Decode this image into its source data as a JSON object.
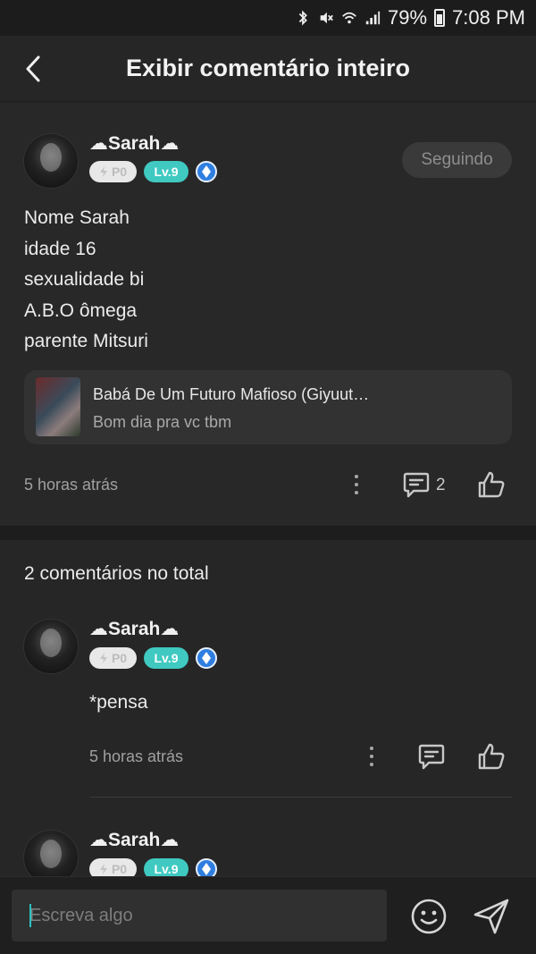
{
  "status_bar": {
    "battery": "79%",
    "time": "7:08 PM"
  },
  "header": {
    "title": "Exibir comentário inteiro"
  },
  "post": {
    "username": "☁Sarah☁",
    "badge_p": "P0",
    "badge_lv": "Lv.9",
    "follow_label": "Seguindo",
    "text_lines": [
      "Nome Sarah",
      "idade 16",
      "sexualidade bi",
      "A.B.O ômega",
      "parente Mitsuri"
    ],
    "linked": {
      "title": "Babá De Um Futuro Mafioso (Giyuut…",
      "subtitle": "Bom dia pra vc tbm"
    },
    "time": "5 horas atrás",
    "comment_count": "2"
  },
  "comments_section": {
    "total_label": "2 comentários no total",
    "comments": [
      {
        "username": "☁Sarah☁",
        "badge_p": "P0",
        "badge_lv": "Lv.9",
        "text": "*pensa",
        "time": "5 horas atrás"
      },
      {
        "username": "☁Sarah☁",
        "badge_p": "P0",
        "badge_lv": "Lv.9"
      }
    ]
  },
  "composer": {
    "placeholder": "Escreva algo"
  },
  "colors": {
    "background": "#262626",
    "accent_teal": "#3fc9c1",
    "badge_blue": "#2f7ee0"
  }
}
